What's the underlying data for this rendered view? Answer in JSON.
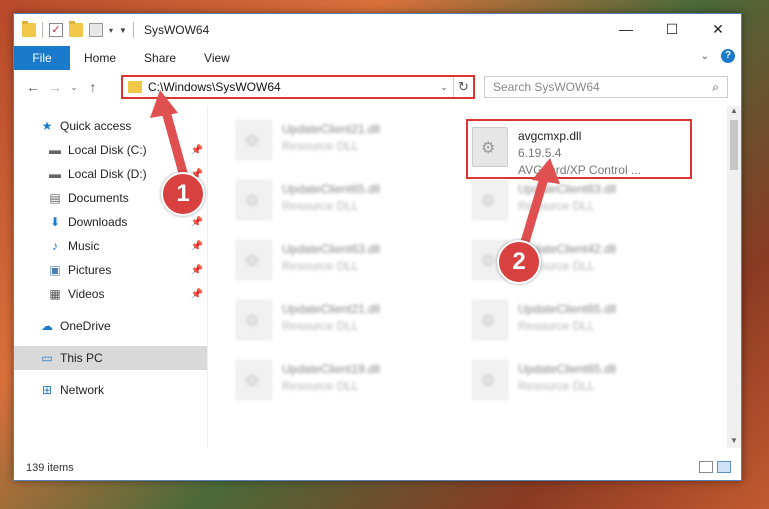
{
  "window": {
    "title": "SysWOW64",
    "controls": [
      "—",
      "☐",
      "✕"
    ]
  },
  "ribbon": {
    "file": "File",
    "tabs": [
      "Home",
      "Share",
      "View"
    ]
  },
  "nav": {
    "address": "C:\\Windows\\SysWOW64",
    "search_placeholder": "Search SysWOW64"
  },
  "sidebar": {
    "items": [
      {
        "label": "Quick access",
        "icon": "star-icon"
      },
      {
        "label": "Local Disk (C:)",
        "icon": "drive-icon"
      },
      {
        "label": "Local Disk (D:)",
        "icon": "drive-icon"
      },
      {
        "label": "Documents",
        "icon": "documents-icon"
      },
      {
        "label": "Downloads",
        "icon": "download-icon"
      },
      {
        "label": "Music",
        "icon": "music-icon"
      },
      {
        "label": "Pictures",
        "icon": "pictures-icon"
      },
      {
        "label": "Videos",
        "icon": "videos-icon"
      },
      {
        "label": "OneDrive",
        "icon": "cloud-icon"
      },
      {
        "label": "This PC",
        "icon": "computer-icon"
      },
      {
        "label": "Network",
        "icon": "network-icon"
      }
    ]
  },
  "files": {
    "highlighted": {
      "name": "avgcmxp.dll",
      "version": "6.19.5.4",
      "description": "AVGuard/XP Control ..."
    },
    "blurred": [
      {
        "name": "UpdateClient21.dll",
        "type": "Resource DLL"
      },
      {
        "name": "UpdateClient65.dll",
        "type": "Resource DLL"
      },
      {
        "name": "UpdateClient63.dll",
        "type": "Resource DLL"
      },
      {
        "name": "UpdateClient21.dll",
        "type": "Resource DLL"
      },
      {
        "name": "UpdateClient19.dll",
        "type": "Resource DLL"
      },
      {
        "name": "UpdateClient63.dll",
        "type": "Resource DLL"
      },
      {
        "name": "UpdateClient42.dll",
        "type": "Resource DLL"
      },
      {
        "name": "UpdateClient65.dll",
        "type": "Resource DLL"
      },
      {
        "name": "UpdateClient65.dll",
        "type": "Resource DLL"
      }
    ]
  },
  "status": {
    "count": "139 items"
  },
  "callouts": [
    "1",
    "2"
  ],
  "colors": {
    "accent": "#1979ca",
    "highlight": "#dd3333"
  }
}
